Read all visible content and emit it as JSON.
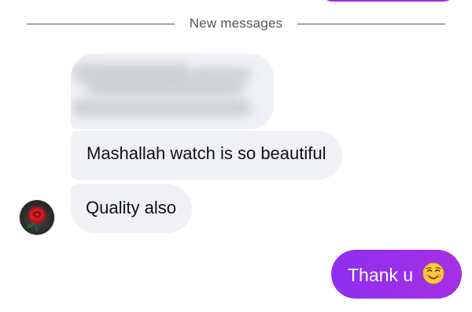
{
  "divider": {
    "label": "New messages"
  },
  "incoming_messages": [
    {
      "text": "Mashallah watch is so beautiful"
    },
    {
      "text": "Quality also"
    }
  ],
  "sender": {
    "avatar_icon": "red-rose-avatar"
  },
  "outgoing_messages": [
    {
      "text": "Thank u",
      "emoji": "smiling-face-with-blush-emoji"
    }
  ],
  "colors": {
    "incoming_bubble": "#eff1f4",
    "outgoing_bubble": "#9a2fe8",
    "divider_text": "#555555"
  }
}
